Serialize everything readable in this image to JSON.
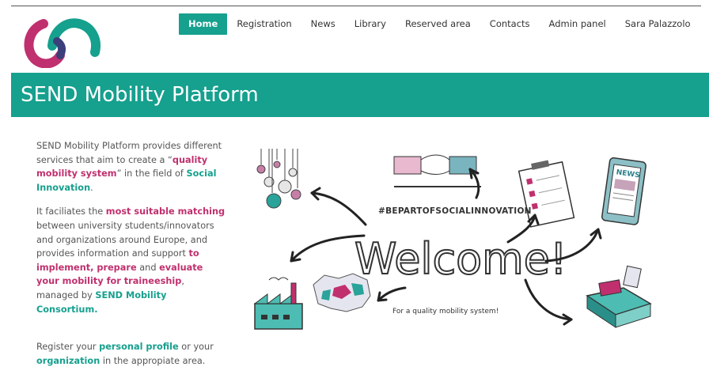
{
  "nav": {
    "items": [
      {
        "label": "Home",
        "active": true
      },
      {
        "label": "Registration"
      },
      {
        "label": "News"
      },
      {
        "label": "Library"
      },
      {
        "label": "Reserved area"
      },
      {
        "label": "Contacts"
      },
      {
        "label": "Admin panel"
      },
      {
        "label": "Sara Palazzolo"
      }
    ]
  },
  "banner": {
    "title": "SEND Mobility Platform"
  },
  "intro": {
    "p1": {
      "t1": "SEND Mobility Platform provides different services that aim to create a “",
      "hl1": "quality mobility system",
      "t2": "” in the field of ",
      "hl2": "Social Innovation",
      "t3": "."
    },
    "p2": {
      "t1": "It faciliates the ",
      "hl1": "most suitable matching",
      "t2": " between university students/innovators and organizations around Europe, and provides information and support ",
      "hl2": "to implement, prepare",
      "t3": " and ",
      "hl3": "evaluate your mobility for traineeship",
      "t4": ", managed by ",
      "hl4": "SEND Mobility Consortium.",
      "t5": ""
    },
    "p3": {
      "t1": "Register your ",
      "hl1": "personal profile",
      "t2": " or your ",
      "hl2": "organization",
      "t3": " in the appropiate area."
    }
  },
  "hero": {
    "hashtag": "#BEPARTOFSOCIALINNOVATION",
    "welcome": "Welcome!",
    "tagline": "For a quality mobility system!",
    "news_label": "NEWS"
  },
  "colors": {
    "accent": "#16a08e",
    "highlight": "#c0306e"
  }
}
